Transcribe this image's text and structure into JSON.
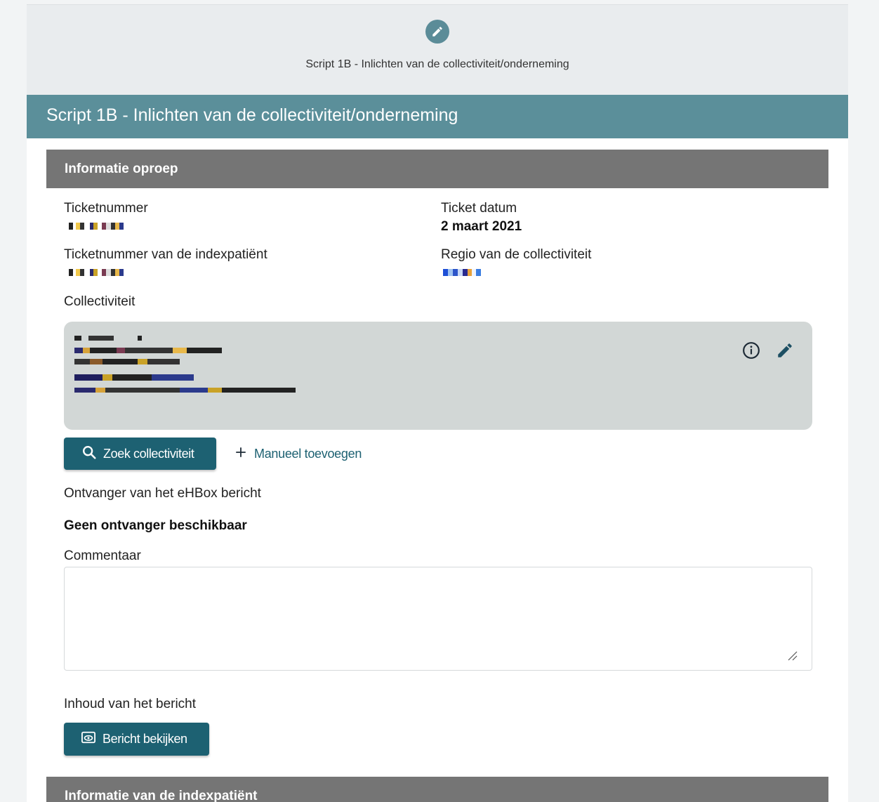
{
  "step": {
    "icon": "pencil-icon",
    "label": "Script 1B - Inlichten van de collectiviteit/onderneming"
  },
  "title": "Script 1B - Inlichten van de collectiviteit/onderneming",
  "section_call": {
    "title": "Informatie oproep",
    "ticket_number_label": "Ticketnummer",
    "ticket_date_label": "Ticket datum",
    "ticket_date_value": "2 maart 2021",
    "index_ticket_label": "Ticketnummer van de indexpatiënt",
    "region_label": "Regio van de collectiviteit",
    "collectivity_label": "Collectiviteit",
    "search_button": "Zoek collectiviteit",
    "add_manual_link": "Manueel toevoegen",
    "recipient_label": "Ontvanger van het eHBox bericht",
    "recipient_value": "Geen ontvanger beschikbaar",
    "comment_label": "Commentaar",
    "comment_value": "",
    "content_label": "Inhoud van het bericht",
    "view_message_button": "Bericht bekijken"
  },
  "section_index": {
    "title": "Informatie van de indexpatiënt"
  },
  "colors": {
    "accent": "#5b8f9a",
    "button": "#1d6172",
    "section": "#757575",
    "card": "#d2d7d6"
  }
}
